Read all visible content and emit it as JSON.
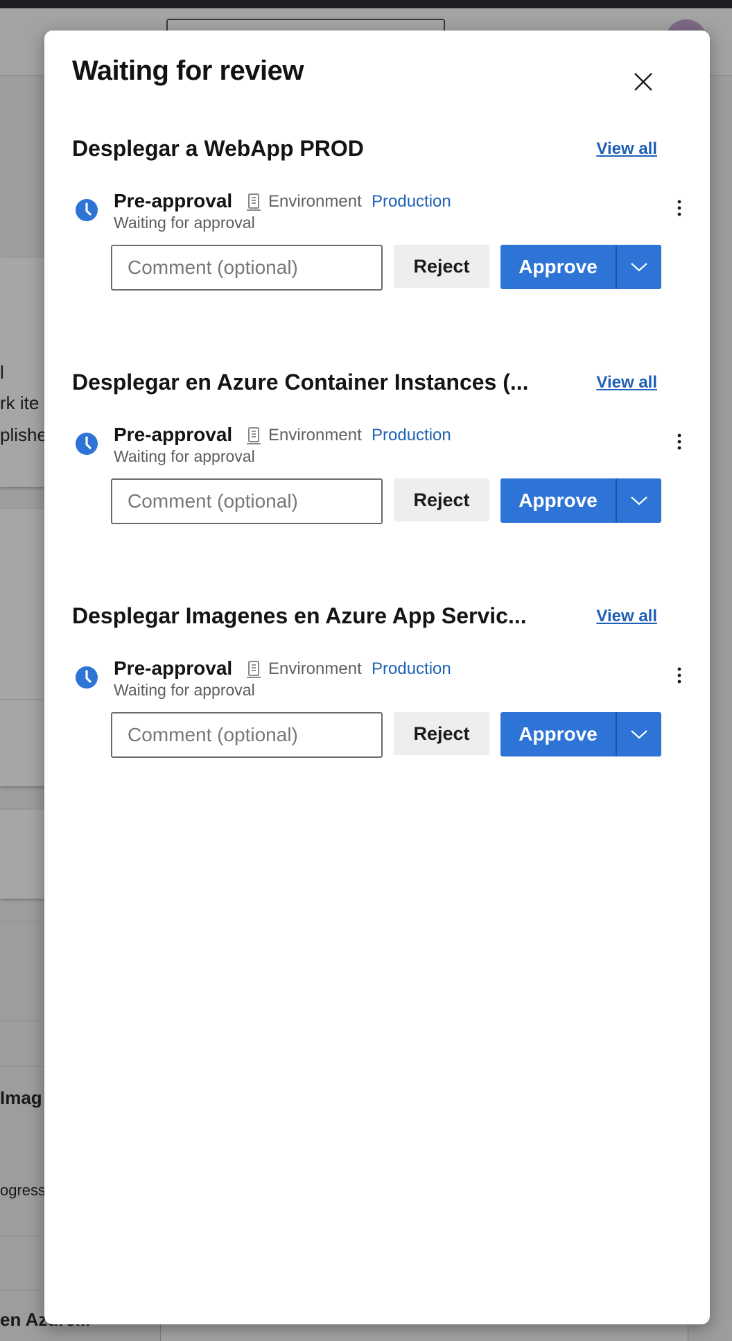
{
  "modal": {
    "title": "Waiting for review",
    "close_icon": "close-icon"
  },
  "background": {
    "texts": [
      "l",
      "rk ite",
      "plishe",
      "Imag",
      "ogress",
      "en Azure..."
    ]
  },
  "sections": [
    {
      "title": "Desplegar a WebApp PROD",
      "view_all": "View all",
      "stage": "Pre-approval",
      "env_label": "Environment",
      "env_name": "Production",
      "status": "Waiting for approval",
      "comment_placeholder": "Comment (optional)",
      "reject": "Reject",
      "approve": "Approve"
    },
    {
      "title": "Desplegar en Azure Container Instances (...",
      "view_all": "View all",
      "stage": "Pre-approval",
      "env_label": "Environment",
      "env_name": "Production",
      "status": "Waiting for approval",
      "comment_placeholder": "Comment (optional)",
      "reject": "Reject",
      "approve": "Approve"
    },
    {
      "title": "Desplegar Imagenes en Azure App Servic...",
      "view_all": "View all",
      "stage": "Pre-approval",
      "env_label": "Environment",
      "env_name": "Production",
      "status": "Waiting for approval",
      "comment_placeholder": "Comment (optional)",
      "reject": "Reject",
      "approve": "Approve"
    }
  ],
  "colors": {
    "accent": "#2D74D6",
    "link": "#1F5FB8",
    "stage_icon": "#2D74D6"
  },
  "icons": {
    "stage": "clock-icon",
    "environment": "environment-icon",
    "more": "more-vertical-icon",
    "dropdown": "chevron-down-icon"
  }
}
